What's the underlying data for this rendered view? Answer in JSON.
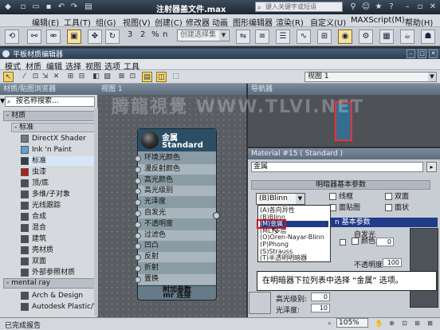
{
  "app": {
    "title": "注射器盖文件.max",
    "search_placeholder": "键入关键字或短语"
  },
  "main_menu": [
    "编辑(E)",
    "工具(T)",
    "组(G)",
    "视图(V)",
    "创建(C)",
    "修改器",
    "动画",
    "图形编辑器",
    "渲染(R)",
    "自定义(U)",
    "MAXScript(M)",
    "帮助(H)"
  ],
  "toolbar": {
    "selection_set_placeholder": "创建选择集",
    "labels": {
      "snap3": "3",
      "snap2": "2",
      "pct": "%",
      "n": "n"
    }
  },
  "sme": {
    "title": "平板材质编辑器",
    "menu": [
      "模式",
      "材质",
      "编辑",
      "选择",
      "视图",
      "选项",
      "工具"
    ],
    "view_select": "视图 1"
  },
  "browser": {
    "header": "材质/贴图浏览器",
    "search_placeholder": "按名称搜索...",
    "group_materials": "- 材质",
    "subgroup_standard": "- 标准",
    "items": [
      {
        "label": "DirectX Shader",
        "color": "#6f7880"
      },
      {
        "label": "Ink 'n Paint",
        "color": "#5aa2d8"
      },
      {
        "label": "标准",
        "color": "#3a3f45"
      },
      {
        "label": "虫漆",
        "color": "#b22018"
      },
      {
        "label": "顶/底",
        "color": "#4a4f55"
      },
      {
        "label": "多维/子对象",
        "color": "#4a4f55"
      },
      {
        "label": "光线跟踪",
        "color": "#4a4f55"
      },
      {
        "label": "合成",
        "color": "#4a4f55"
      },
      {
        "label": "混合",
        "color": "#4a4f55"
      },
      {
        "label": "建筑",
        "color": "#4a4f55"
      },
      {
        "label": "壳材质",
        "color": "#4a4f55"
      },
      {
        "label": "双面",
        "color": "#4a4f55"
      },
      {
        "label": "外部参照材质",
        "color": "#4a4f55"
      }
    ],
    "group_mentalray": "- mental ray",
    "mr_items": [
      {
        "label": "Arch & Design",
        "color": "#4a4f55"
      },
      {
        "label": "Autodesk Plastic/Vinyl",
        "color": "#4a4f55"
      }
    ]
  },
  "view1": {
    "header": "视图 1"
  },
  "node": {
    "title": "金属",
    "subtitle": "Standard",
    "slots": [
      "环境光颜色",
      "漫反射颜色",
      "高光颜色",
      "高光级别",
      "光泽度",
      "自发光",
      "不透明度",
      "过滤色",
      "凹凸",
      "反射",
      "折射",
      "置换"
    ],
    "foot1": "附加参数",
    "foot2": "mr 连接"
  },
  "navigator": {
    "header": "导航器"
  },
  "params": {
    "header": "Material #15 ( Standard )",
    "material_name": "金属",
    "rollout_shader": "明暗器基本参数",
    "shader_current": "(B)Blinn",
    "options": {
      "wire": "线框",
      "two_sided": "双面",
      "face_map": "面贴图",
      "faceted": "面状"
    },
    "shader_list": [
      "(A)各向异性",
      "(B)Blinn",
      "(M)金属",
      "(ML)多层",
      "(O)Oren-Nayar-Blinn",
      "(P)Phong",
      "(S)Strauss",
      "(T)半透明明暗器"
    ],
    "rollout_basic_suffix": "n 基本参数",
    "self_illum": "自发光",
    "color_label": "颜色",
    "color_value": "0",
    "opacity_label": "不透明度:",
    "opacity_value": "100",
    "specular_level_label": "高光级别:",
    "specular_level_value": "0",
    "glossiness_label": "光泽度:",
    "glossiness_value": "10"
  },
  "callout": "在明暗器下拉列表中选择 “金属” 选项。",
  "status": {
    "text": "已完成报告",
    "zoom": "105%"
  },
  "watermark": "腾龍視覺 WWW.TLVI.NET"
}
